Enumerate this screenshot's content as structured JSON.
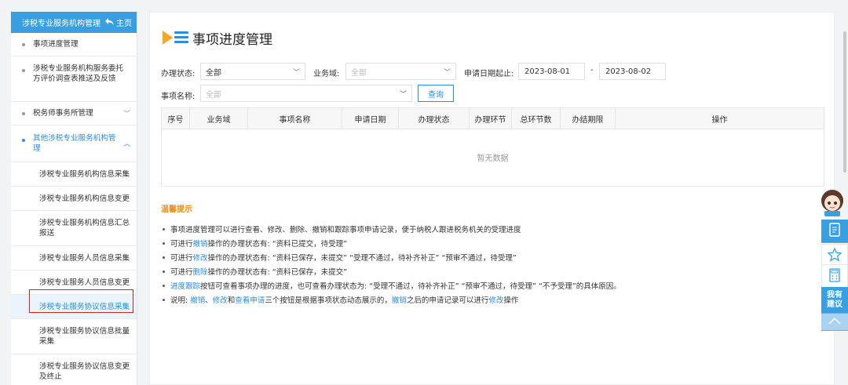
{
  "sidebar": {
    "header_title": "涉税专业服务机构管理",
    "home_label": "主页",
    "items": [
      {
        "label": "事项进度管理"
      },
      {
        "label": "涉税专业服务机构服务委托方评价调查表推送及反馈"
      },
      {
        "label": "税务师事务所管理",
        "chevron": "﹀"
      },
      {
        "label": "其他涉税专业服务机构管理",
        "chevron": "︿"
      }
    ],
    "sub_items": [
      {
        "label": "涉税专业服务机构信息采集"
      },
      {
        "label": "涉税专业服务机构信息变更"
      },
      {
        "label": "涉税专业服务机构信息汇总报送"
      },
      {
        "label": "涉税专业服务人员信息采集"
      },
      {
        "label": "涉税专业服务人员信息变更"
      },
      {
        "label": "涉税专业服务协议信息采集"
      },
      {
        "label": "涉税专业服务协议信息批量采集"
      },
      {
        "label": "涉税专业服务协议信息变更及终止"
      }
    ]
  },
  "main": {
    "title": "事项进度管理",
    "filters": {
      "status_label": "办理状态:",
      "status_value": "全部",
      "domain_label": "业务域:",
      "domain_placeholder": "全部",
      "date_label": "申请日期起止:",
      "date_from": "2023-08-01",
      "date_sep": "-",
      "date_to": "2023-08-02",
      "item_label": "事项名称:",
      "item_placeholder": "全部",
      "query_button": "查询"
    },
    "table": {
      "columns": [
        "序号",
        "业务域",
        "事项名称",
        "申请日期",
        "办理状态",
        "办理环节",
        "总环节数",
        "办结期限",
        "操作"
      ],
      "empty_text": "暂无数据"
    },
    "tips_title": "温馨提示",
    "tips": [
      {
        "parts": [
          {
            "t": "事项进度管理可以进行查看、修改、删除、撤销和跟踪事项申请记录，便于纳税人跟进税务机关的受理进度"
          }
        ]
      },
      {
        "parts": [
          {
            "t": "可进行"
          },
          {
            "t": "撤销",
            "link": true
          },
          {
            "t": "操作的办理状态有: “资料已提交，待受理”"
          }
        ]
      },
      {
        "parts": [
          {
            "t": "可进行"
          },
          {
            "t": "修改",
            "link": true
          },
          {
            "t": "操作的办理状态有: “资料已保存，未提交” “受理不通过，待补齐补正” “预审不通过，待受理”"
          }
        ]
      },
      {
        "parts": [
          {
            "t": "可进行"
          },
          {
            "t": "删除",
            "link": true
          },
          {
            "t": "操作的办理状态有: “资料已保存，未提交”"
          }
        ]
      },
      {
        "parts": [
          {
            "t": "进度跟踪",
            "link": true
          },
          {
            "t": "按钮可查看事项办理的进度，也可查看办理状态为: “受理不通过，待补齐补正” “预审不通过，待受理” “不予受理”的具体原因。"
          }
        ]
      },
      {
        "parts": [
          {
            "t": "说明: "
          },
          {
            "t": "撤销",
            "link": true
          },
          {
            "t": "、"
          },
          {
            "t": "修改",
            "link": true
          },
          {
            "t": "和"
          },
          {
            "t": "查看申请",
            "link": true
          },
          {
            "t": "三个按钮是根据事项状态动态展示的，"
          },
          {
            "t": "撤销",
            "link": true
          },
          {
            "t": "之后的申请记录可以进行"
          },
          {
            "t": "修改",
            "link": true
          },
          {
            "t": "操作"
          }
        ]
      }
    ]
  },
  "float_bar": {
    "avatar_icon": "assistant-avatar-icon",
    "buttons": [
      {
        "icon": "document-icon"
      },
      {
        "icon": "star-icon"
      },
      {
        "icon": "calculator-icon"
      },
      {
        "label1": "我有",
        "label2": "建议"
      },
      {
        "icon": "chevron-up-icon"
      }
    ]
  },
  "colors": {
    "accent": "#3a9fe0",
    "link": "#2d8ce0",
    "tip_title": "#f08c1e",
    "highlight_box": "#e02020"
  }
}
